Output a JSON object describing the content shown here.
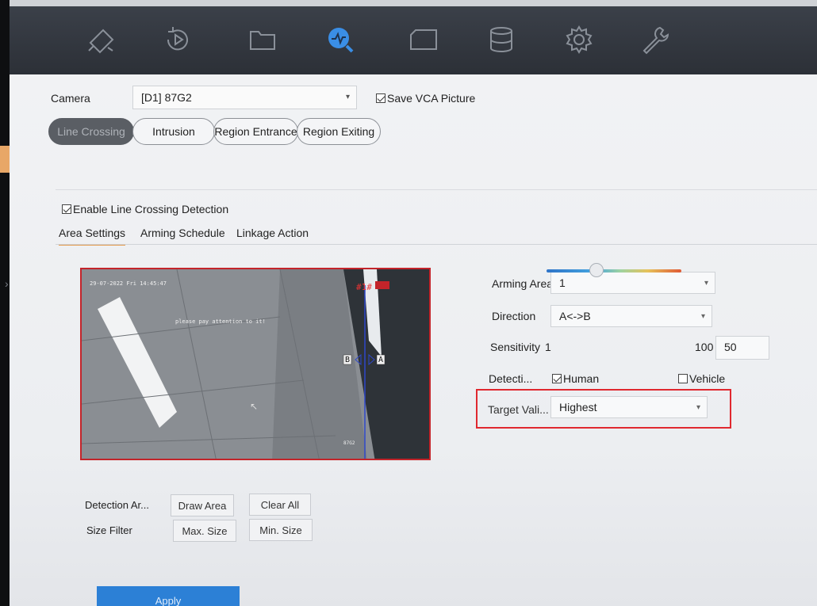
{
  "nav": {
    "icons": [
      "camera-icon",
      "playback-icon",
      "file-icon",
      "vca-search-icon",
      "video-icon",
      "storage-icon",
      "settings-icon",
      "maintenance-icon"
    ],
    "active_index": 3,
    "accent": "#3a8ee6"
  },
  "camera": {
    "label": "Camera",
    "selected": "[D1] 87G2",
    "save_vca_label": "Save VCA Picture",
    "save_vca_checked": true
  },
  "event_tabs": [
    {
      "label": "Line Crossing",
      "active": true
    },
    {
      "label": "Intrusion",
      "active": false
    },
    {
      "label": "Region Entrance",
      "active": false
    },
    {
      "label": "Region Exiting",
      "active": false
    }
  ],
  "enable": {
    "label": "Enable Line Crossing Detection",
    "checked": true
  },
  "sub_tabs": [
    {
      "label": "Area Settings",
      "active": true
    },
    {
      "label": "Arming Schedule",
      "active": false
    },
    {
      "label": "Linkage Action",
      "active": false
    }
  ],
  "preview": {
    "timestamp": "29-07-2022 Fri 14:45:47",
    "overlay_text": "please pay attention to it!",
    "line_id": "#1#",
    "label_b": "B",
    "label_a": "A",
    "camera_name": "87G2"
  },
  "settings": {
    "arming_area_label": "Arming Area",
    "arming_area_value": "1",
    "direction_label": "Direction",
    "direction_value": "A<->B",
    "sensitivity_label": "Sensitivity",
    "sensitivity_min": "1",
    "sensitivity_max": "100",
    "sensitivity_value": "50",
    "sensitivity_fraction": 0.5,
    "detection_label": "Detecti...",
    "human_label": "Human",
    "human_checked": true,
    "vehicle_label": "Vehicle",
    "vehicle_checked": false,
    "target_label": "Target Vali...",
    "target_value": "Highest"
  },
  "area_controls": {
    "detection_area_label": "Detection Ar...",
    "draw_area": "Draw Area",
    "clear_all": "Clear All",
    "size_filter_label": "Size Filter",
    "max_size": "Max. Size",
    "min_size": "Min. Size"
  },
  "apply_label": "Apply"
}
